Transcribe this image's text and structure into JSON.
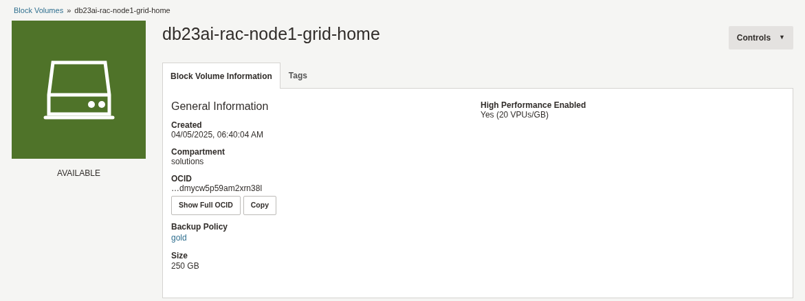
{
  "breadcrumb": [
    {
      "label": "Block Volumes",
      "kind": "link"
    },
    {
      "label": "db23ai-rac-node1-grid-home",
      "kind": "current"
    }
  ],
  "breadcrumb_separator": "»",
  "resource": {
    "status": "AVAILABLE",
    "color": "#4f7329"
  },
  "title": "db23ai-rac-node1-grid-home",
  "controls_button": {
    "label": "Controls",
    "caret": "▼"
  },
  "tabs": [
    {
      "label": "Block Volume Information",
      "selected": true
    },
    {
      "label": "Tags",
      "selected": false
    }
  ],
  "section_heading": "General Information",
  "left_fields": [
    {
      "label": "Created",
      "value": "04/05/2025, 06:40:04 AM",
      "kind": "text"
    },
    {
      "label": "Compartment",
      "value": "solutions",
      "kind": "text"
    },
    {
      "label": "OCID",
      "value": "…dmycw5p59am2xrn38l",
      "kind": "ocid",
      "buttons": [
        "Show Full OCID",
        "Copy"
      ]
    },
    {
      "label": "Backup Policy",
      "value": "gold",
      "kind": "link"
    },
    {
      "label": "Size",
      "value": "250 GB",
      "kind": "text"
    }
  ],
  "right_fields": [
    {
      "label": "High Performance Enabled",
      "value": "Yes (20 VPUs/GB)",
      "kind": "text"
    }
  ]
}
